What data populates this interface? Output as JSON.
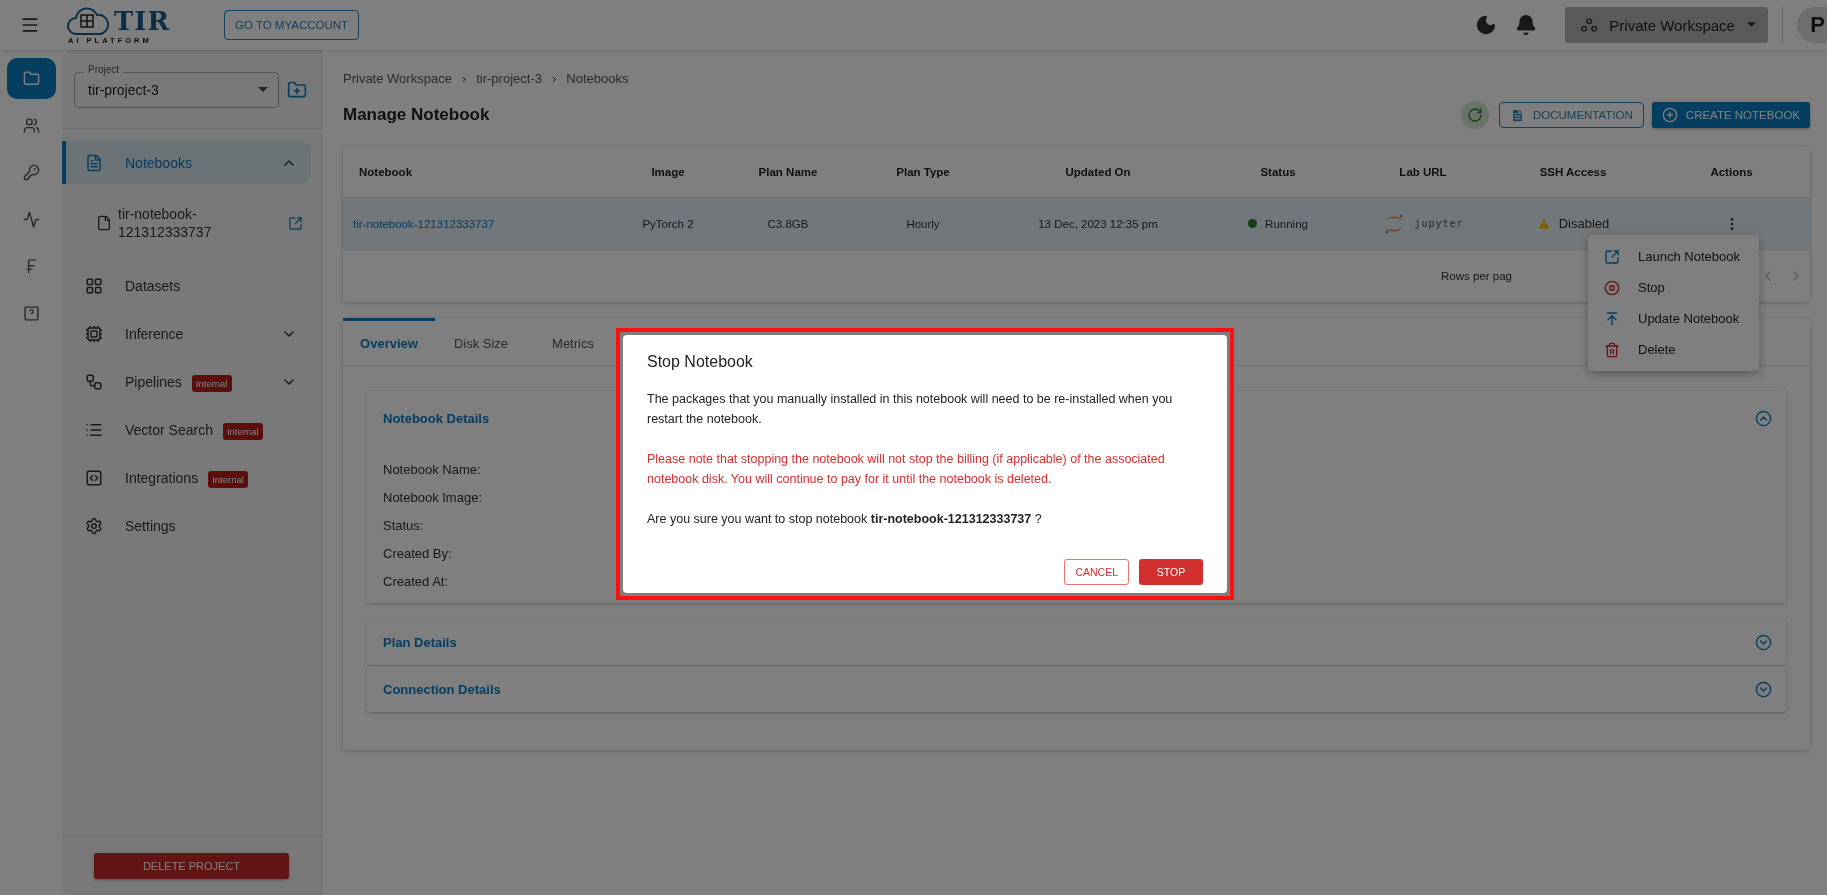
{
  "topbar": {
    "logo_title": "TIR",
    "logo_subtitle": "AI PLATFORM",
    "account_button": "GO TO MYACCOUNT",
    "workspace": "Private Workspace",
    "avatar": "P"
  },
  "rail": [
    {
      "kind": "folder",
      "selected": true
    },
    {
      "kind": "team",
      "selected": false
    },
    {
      "kind": "key",
      "selected": false
    },
    {
      "kind": "analytics",
      "selected": false
    },
    {
      "kind": "billing",
      "selected": false
    },
    {
      "kind": "help",
      "selected": false
    }
  ],
  "project": {
    "label": "Project",
    "value": "tir-project-3"
  },
  "nav": [
    {
      "kind": "notebook",
      "label": "Notebooks",
      "selected": true,
      "expanded": true,
      "children": [
        {
          "label": "tir-notebook-121312333737"
        }
      ]
    },
    {
      "kind": "datasets",
      "label": "Datasets",
      "selected": false
    },
    {
      "kind": "inference",
      "label": "Inference",
      "selected": false,
      "expanded": false
    },
    {
      "kind": "pipelines",
      "label": "Pipelines",
      "badge": "Internal",
      "selected": false,
      "expanded": false
    },
    {
      "kind": "vector",
      "label": "Vector Search",
      "badge": "Internal",
      "selected": false
    },
    {
      "kind": "integrations",
      "label": "Integrations",
      "badge": "Internal",
      "selected": false
    },
    {
      "kind": "settings",
      "label": "Settings",
      "selected": false
    }
  ],
  "delete_button": "DELETE PROJECT",
  "breadcrumb": {
    "separator": "›",
    "items": [
      "Private Workspace",
      "tir-project-3",
      "Notebooks"
    ]
  },
  "page_title": "Manage Notebook",
  "actions": {
    "documentation": "DOCUMENTATION",
    "create": "CREATE NOTEBOOK"
  },
  "table": {
    "columns": [
      "Notebook",
      "Image",
      "Plan Name",
      "Plan Type",
      "Updated On",
      "Status",
      "Lab URL",
      "SSH Access",
      "Actions"
    ],
    "rows": [
      {
        "selected": true,
        "notebook": "tir-notebook-121312333737",
        "image": "PyTorch 2",
        "plan_name": "C3.8GB",
        "plan_type": "Hourly",
        "updated_on": "13 Dec, 2023 12:35 pm",
        "status": "Running",
        "lab_url": "jupyter",
        "ssh_access": "Disabled"
      }
    ],
    "footer": "Rows per pag"
  },
  "row_menu": [
    {
      "kind": "launch",
      "label": "Launch Notebook"
    },
    {
      "kind": "stop",
      "label": "Stop"
    },
    {
      "kind": "update",
      "label": "Update Notebook"
    },
    {
      "kind": "delete",
      "label": "Delete"
    }
  ],
  "tabs": [
    {
      "label": "Overview",
      "selected": true
    },
    {
      "label": "Disk Size",
      "selected": false
    },
    {
      "label": "Metrics",
      "selected": false
    }
  ],
  "sections": [
    {
      "title": "Notebook Details",
      "expanded": true,
      "fields": [
        "Notebook Name:",
        "Notebook Image:",
        "Status:",
        "Created By:",
        "Created At:"
      ]
    },
    {
      "title": "Plan Details",
      "expanded": false
    },
    {
      "title": "Connection Details",
      "expanded": false
    }
  ],
  "dialog": {
    "title": "Stop Notebook",
    "message": "The packages that you manually installed in this notebook will need to be re-installed when you restart the notebook.",
    "warning": "Please note that stopping the notebook will not stop the billing (if applicable) of the associated notebook disk. You will continue to pay for it until the notebook is deleted.",
    "question": "Are you sure you want to stop notebook **tir-notebook-121312333737** ?",
    "cancel": "CANCEL",
    "confirm": "STOP"
  }
}
